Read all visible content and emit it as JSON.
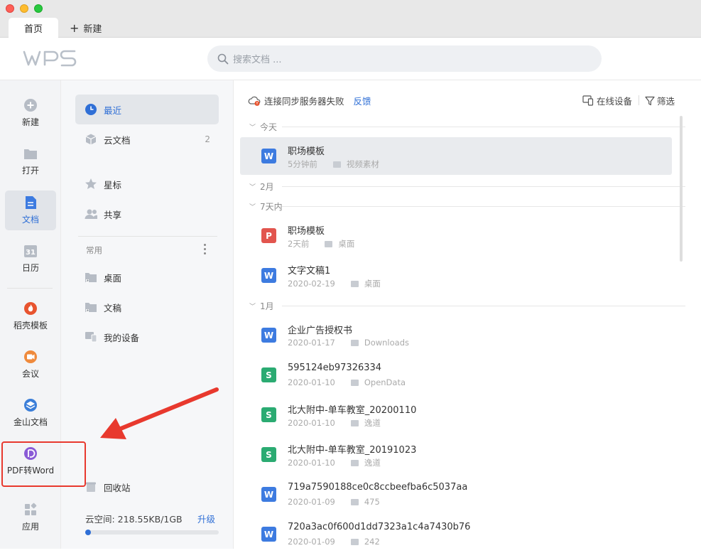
{
  "window": {
    "tabs": [
      {
        "label": "首页"
      }
    ],
    "new_tab_label": "新建"
  },
  "header": {
    "logo": "WPS",
    "search_placeholder": "搜索文档 ..."
  },
  "leftnav": [
    {
      "label": "新建",
      "icon": "plus-circle-icon"
    },
    {
      "label": "打开",
      "icon": "folder-icon"
    },
    {
      "label": "文档",
      "icon": "document-icon",
      "active": true
    },
    {
      "label": "日历",
      "icon": "calendar-icon"
    },
    {
      "label": "稻壳模板",
      "icon": "flame-icon"
    },
    {
      "label": "会议",
      "icon": "video-icon"
    },
    {
      "label": "金山文档",
      "icon": "layers-icon"
    },
    {
      "label": "PDF转Word",
      "icon": "pdf-convert-icon"
    },
    {
      "label": "应用",
      "icon": "apps-grid-icon"
    }
  ],
  "midnav": {
    "recent": "最近",
    "cloud_docs": {
      "label": "云文档",
      "count": "2"
    },
    "starred": "星标",
    "shared": "共享",
    "common_header": "常用",
    "common_items": [
      "桌面",
      "文稿",
      "我的设备"
    ],
    "recycle_bin": "回收站",
    "cloud_space": {
      "label": "云空间: 218.55KB/1GB",
      "upgrade": "升级",
      "fraction": 0.0002
    }
  },
  "main": {
    "sync_status": "连接同步服务器失败",
    "feedback": "反馈",
    "online_devices": "在线设备",
    "filter": "筛选",
    "groups": [
      {
        "label": "今天",
        "files": [
          {
            "name": "职场模板",
            "time": "5分钟前",
            "location": "视频素材",
            "type": "W",
            "selected": true
          }
        ]
      },
      {
        "label": "2月",
        "files": []
      },
      {
        "label": "7天内",
        "files": [
          {
            "name": "职场模板",
            "time": "2天前",
            "location": "桌面",
            "type": "P"
          },
          {
            "name": "文字文稿1",
            "time": "2020-02-19",
            "location": "桌面",
            "type": "W"
          }
        ]
      },
      {
        "label": "1月",
        "files": [
          {
            "name": "企业广告授权书",
            "time": "2020-01-17",
            "location": "Downloads",
            "type": "W"
          },
          {
            "name": "595124eb97326334",
            "time": "2020-01-10",
            "location": "OpenData",
            "type": "S"
          },
          {
            "name": "北大附中-单车教室_20200110",
            "time": "2020-01-10",
            "location": "逸道",
            "type": "S"
          },
          {
            "name": "北大附中-单车教室_20191023",
            "time": "2020-01-10",
            "location": "逸道",
            "type": "S"
          },
          {
            "name": "719a7590188ce0c8ccbeefba6c5037aa",
            "time": "2020-01-09",
            "location": "475",
            "type": "W"
          },
          {
            "name": "720a3ac0f600d1dd7323a1c4a7430b76",
            "time": "2020-01-09",
            "location": "242",
            "type": "W"
          }
        ]
      }
    ]
  },
  "colors": {
    "accent": "#2f6fd6",
    "writer": "#3d7be0",
    "sheet": "#2bab72",
    "pdf": "#e2554e",
    "annotation_red": "#e8392e"
  }
}
